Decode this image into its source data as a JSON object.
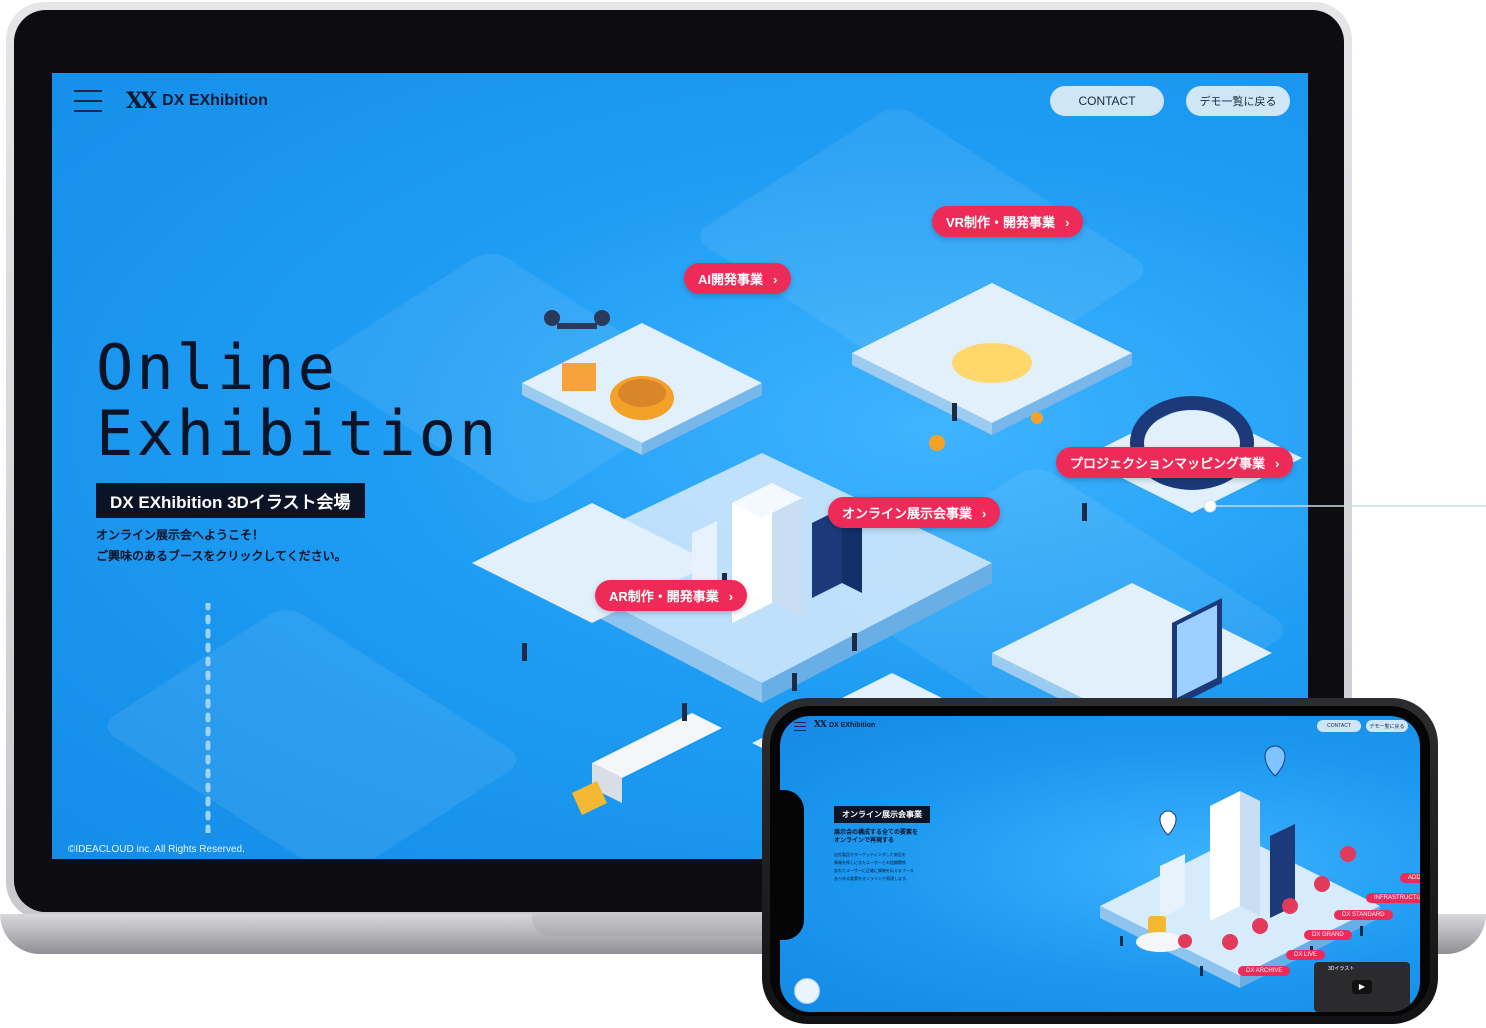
{
  "header": {
    "logo_text": "DX EXhibition",
    "contact_label": "CONTACT",
    "back_label": "デモ一覧に戻る"
  },
  "hero": {
    "title_line1": "Online",
    "title_line2": "Exhibition",
    "badge": "DX EXhibition 3Dイラスト会場",
    "desc_line1": "オンライン展示会へようこそ！",
    "desc_line2": "ご興味のあるブースをクリックしてください。"
  },
  "booths": {
    "vr": "VR制作・開発事業",
    "ai": "AI開発事業",
    "projection": "プロジェクションマッピング事業",
    "online": "オンライン展示会事業",
    "ar": "AR制作・開発事業"
  },
  "footer": {
    "copyright": "©IDEACLOUD inc. All Rights Reserved."
  },
  "phone": {
    "logo_text": "DX EXhibition",
    "contact_label": "CONTACT",
    "back_label": "デモ一覧に戻る",
    "section_badge": "オンライン展示会事業",
    "section_heading_line1": "展示会の構成する全ての要素を",
    "section_heading_line2": "オンラインで再現する",
    "body_line1": "自社製品やターゲッティングした商品を",
    "body_line2": "情報を探しにきたユーザーとの信頼関係",
    "body_line3": "訪れたユーザーに正確に情報を伝えるブース",
    "body_line4": "あらゆる要素をオンラインで再現します。",
    "labels": {
      "addon": "ADD-O",
      "infrastructure": "INFRASTRUCTUR",
      "standard": "DX STANDARD",
      "grand": "DX GRAND",
      "live": "DX LIVE",
      "archive": "DX ARCHIVE"
    },
    "video_label": "3Dイラスト"
  },
  "colors": {
    "background": "#1e9cf3",
    "accent": "#ee2b58",
    "dark": "#0b1427"
  }
}
